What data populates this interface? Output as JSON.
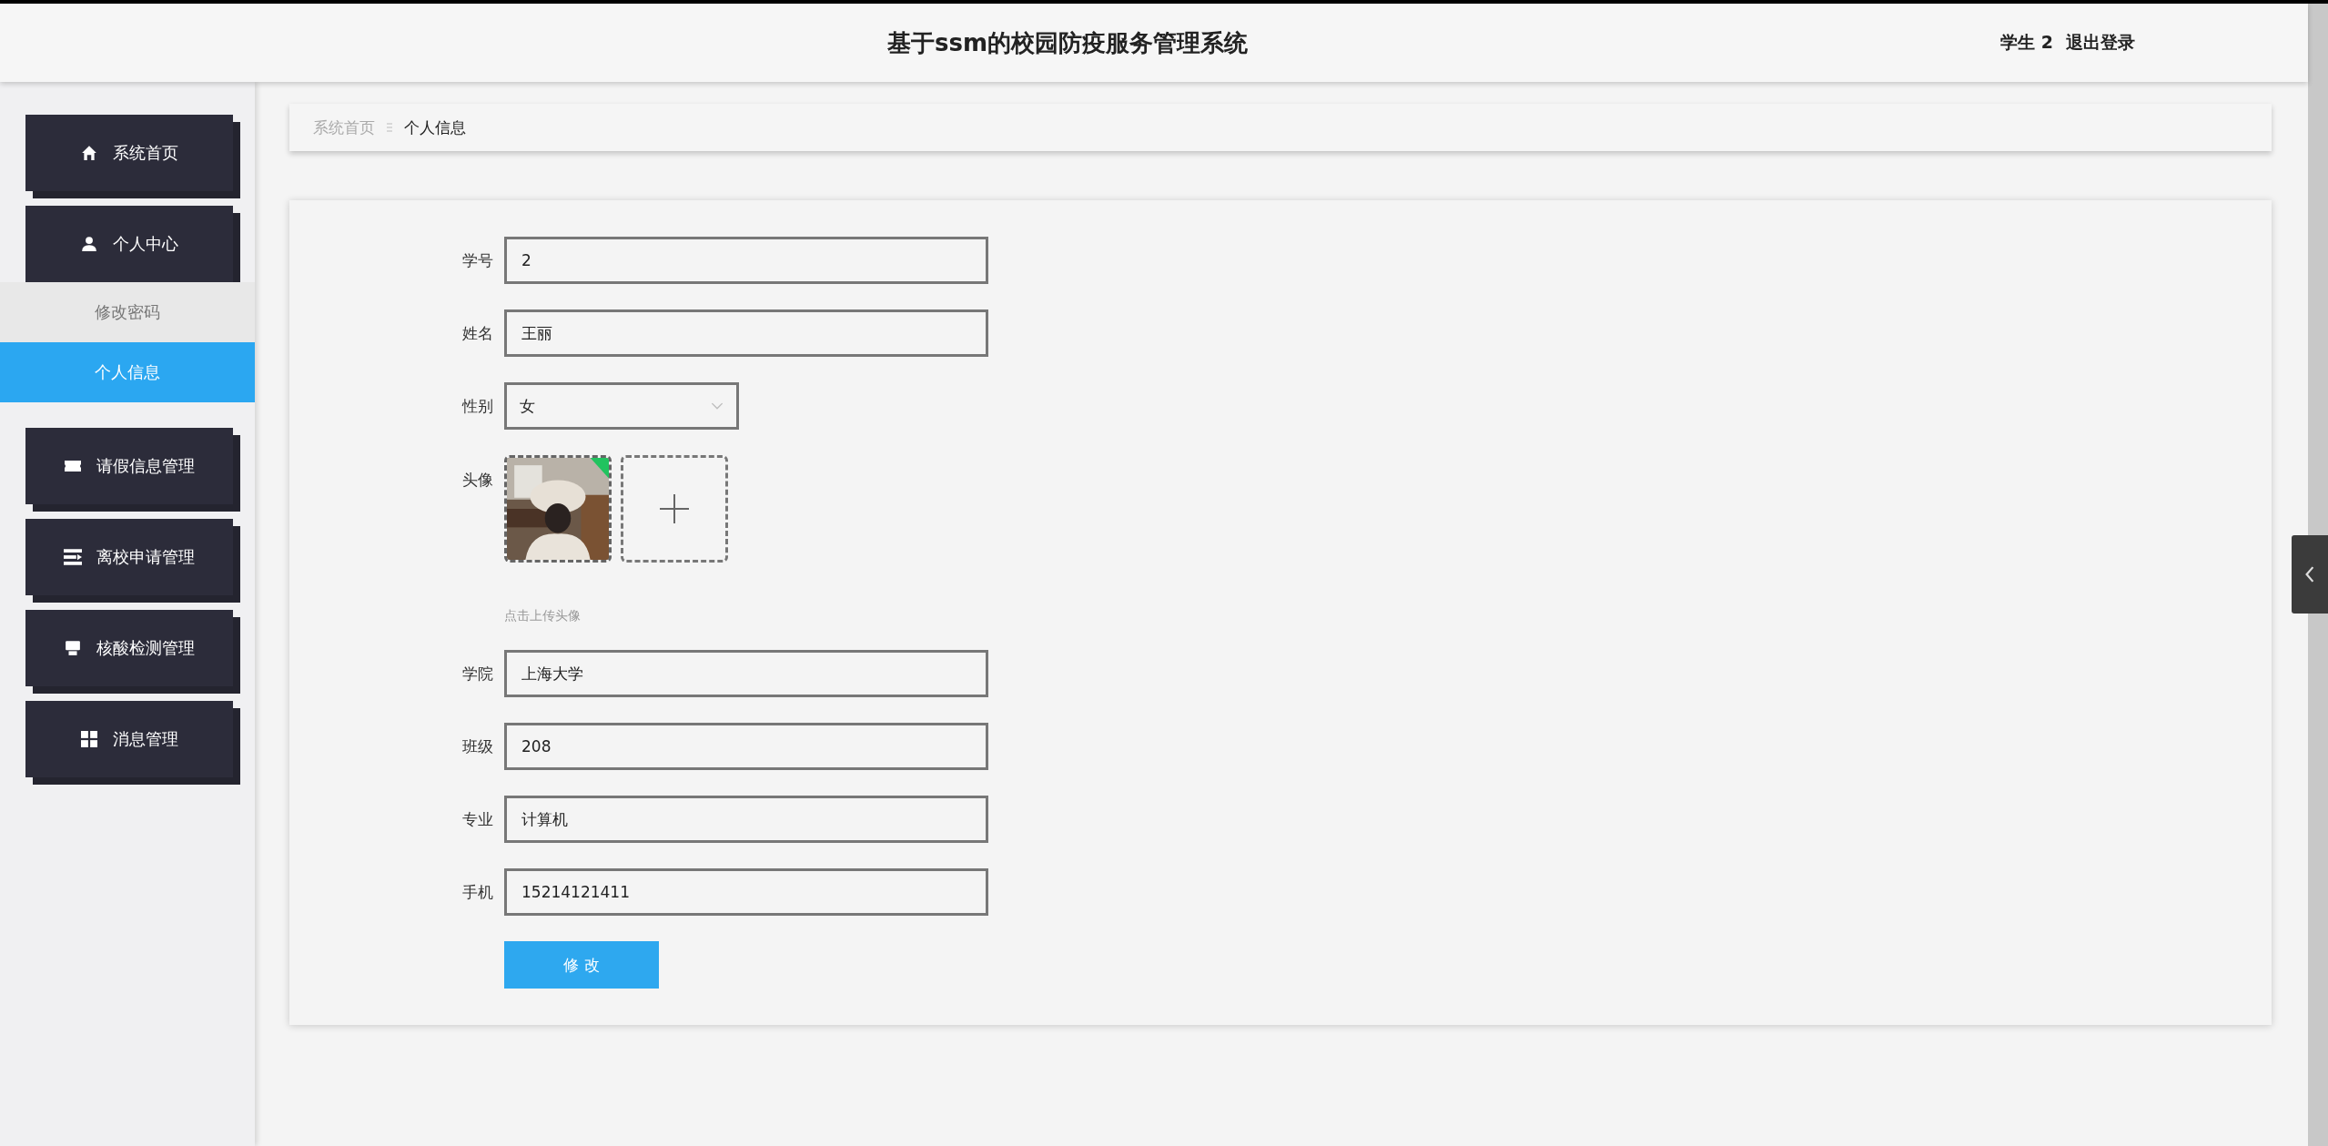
{
  "header": {
    "title": "基于ssm的校园防疫服务管理系统",
    "user": "学生 2",
    "logout": "退出登录"
  },
  "sidebar": {
    "items": [
      {
        "label": "系统首页"
      },
      {
        "label": "个人中心",
        "children": [
          {
            "label": "修改密码",
            "selected": false
          },
          {
            "label": "个人信息",
            "selected": true
          }
        ]
      },
      {
        "label": "请假信息管理"
      },
      {
        "label": "离校申请管理"
      },
      {
        "label": "核酸检测管理"
      },
      {
        "label": "消息管理"
      }
    ]
  },
  "breadcrumb": [
    "系统首页",
    "个人信息"
  ],
  "form": {
    "fields": [
      {
        "kind": "text",
        "label": "学号",
        "value": "2"
      },
      {
        "kind": "text",
        "label": "姓名",
        "value": "王丽"
      },
      {
        "kind": "select",
        "label": "性别",
        "value": "女"
      },
      {
        "kind": "upload",
        "label": "头像",
        "hint": "点击上传头像"
      },
      {
        "kind": "text",
        "label": "学院",
        "value": "上海大学"
      },
      {
        "kind": "text",
        "label": "班级",
        "value": "208"
      },
      {
        "kind": "text",
        "label": "专业",
        "value": "计算机"
      },
      {
        "kind": "text",
        "label": "手机",
        "value": "15214121411"
      }
    ],
    "submit": "修 改"
  }
}
